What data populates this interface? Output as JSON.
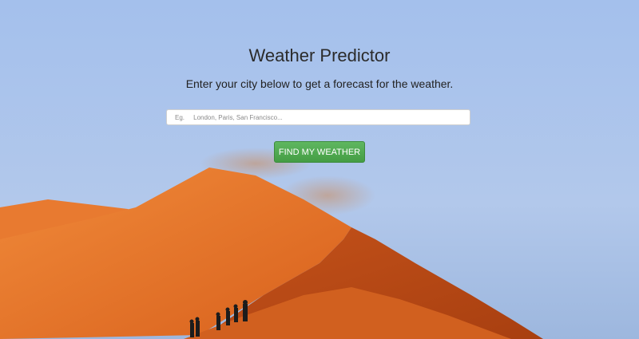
{
  "page": {
    "title": "Weather Predictor",
    "subtitle": "Enter your city below to get a forecast for the weather."
  },
  "search": {
    "placeholder": "Eg.     London, Paris, San Francisco...",
    "value": ""
  },
  "button": {
    "label": "FIND MY WEATHER"
  },
  "background": {
    "scene": "desert-dune-with-hikers",
    "sky_color": "#a9c4ef",
    "sand_color": "#e06a22",
    "button_color": "#4cae4c"
  }
}
